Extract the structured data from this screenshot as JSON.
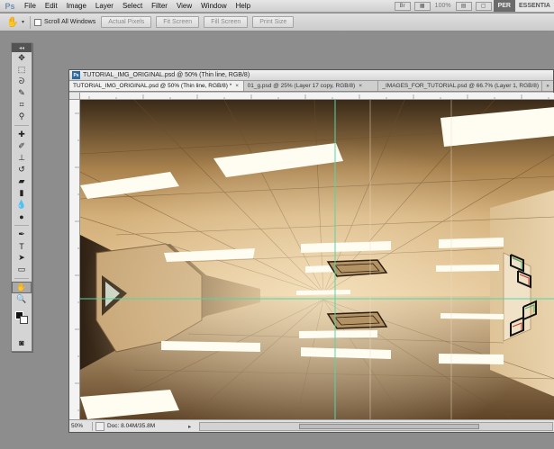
{
  "app": {
    "logo": "Ps"
  },
  "menu": [
    "File",
    "Edit",
    "Image",
    "Layer",
    "Select",
    "Filter",
    "View",
    "Window",
    "Help"
  ],
  "menubar_right": {
    "zoom_value": "100%",
    "workspace_button": "PER",
    "workspace_label": "ESSENTIA"
  },
  "options_bar": {
    "tool_icon": "hand-icon",
    "scroll_all_windows_label": "Scroll All Windows",
    "scroll_all_windows_checked": false,
    "buttons": [
      "Actual Pixels",
      "Fit Screen",
      "Fill Screen",
      "Print Size"
    ]
  },
  "document": {
    "window_title": "TUTORIAL_IMG_ORIGINAL.psd @ 50% (Thin line, RGB/8)",
    "tabs": [
      {
        "label": "TUTORIAL_IMG_ORIGINAL.psd @ 50% (Thin line, RGB/8) *",
        "active": true
      },
      {
        "label": "01_g.psd @ 25% (Layer 17 copy, RGB/8)",
        "active": false
      },
      {
        "label": "_IMAGES_FOR_TUTORIAL.psd @ 66.7% (Layer 1, RGB/8)",
        "active": false
      }
    ],
    "tabs_overflow": "»"
  },
  "status": {
    "zoom": "50%",
    "doc_info": "Doc: 8.04M/35.8M",
    "info_arrow": "▸"
  },
  "colors": {
    "guide": "#4fd8a8",
    "canvas_warm": "#c89a5e",
    "light": "#fffdf2"
  }
}
